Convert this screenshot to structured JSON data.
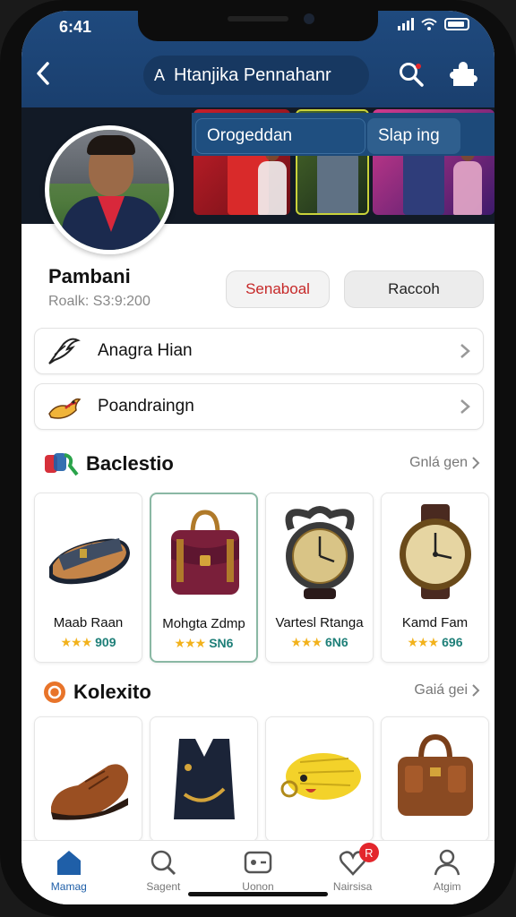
{
  "status": {
    "time": "6:41"
  },
  "header": {
    "title": "Htanjika Pennahanr",
    "prefix": "A"
  },
  "banner": {
    "chip_left": "Orogeddan",
    "chip_right": "Slap ing"
  },
  "profile": {
    "name": "Pambani",
    "subtitle": "Roalk: S3:9:200",
    "button_primary": "Senaboal",
    "button_secondary": "Raccoh"
  },
  "list_rows": [
    {
      "label": "Anagra Hian",
      "icon": "bird-icon"
    },
    {
      "label": "Poandraingn",
      "icon": "dragon-icon"
    }
  ],
  "section1": {
    "title": "Baclestio",
    "see_all": "Gnlá gen",
    "items": [
      {
        "name": "Maab Raan",
        "stars": "★★★",
        "price": "909",
        "icon": "sandal-icon"
      },
      {
        "name": "Mohgta Zdmp",
        "stars": "★★★",
        "price": "SN6",
        "icon": "satchel-icon"
      },
      {
        "name": "Vartesl Rtanga",
        "stars": "★★★",
        "price": "6N6",
        "icon": "pocket-watch-icon"
      },
      {
        "name": "Kamd Fam",
        "stars": "★★★",
        "price": "696",
        "icon": "wristwatch-icon"
      }
    ]
  },
  "section2": {
    "title": "Kolexito",
    "see_all": "Gaiá gei",
    "items": [
      {
        "icon": "shoe-icon"
      },
      {
        "icon": "vest-icon"
      },
      {
        "icon": "yellow-creature-icon"
      },
      {
        "icon": "leather-bag-icon"
      }
    ]
  },
  "tabs": [
    {
      "label": "Mamag",
      "icon": "home-icon",
      "active": true
    },
    {
      "label": "Sagent",
      "icon": "search-icon",
      "active": false
    },
    {
      "label": "Uonon",
      "icon": "controller-icon",
      "active": false
    },
    {
      "label": "Nairsisa",
      "icon": "heart-icon",
      "active": false,
      "badge": "R"
    },
    {
      "label": "Atgim",
      "icon": "profile-icon",
      "active": false
    }
  ],
  "colors": {
    "header": "#1f4a7e",
    "accent": "#1f5fa8",
    "price": "#1e7f78",
    "star": "#f2b21c",
    "badge": "#e3262c"
  }
}
